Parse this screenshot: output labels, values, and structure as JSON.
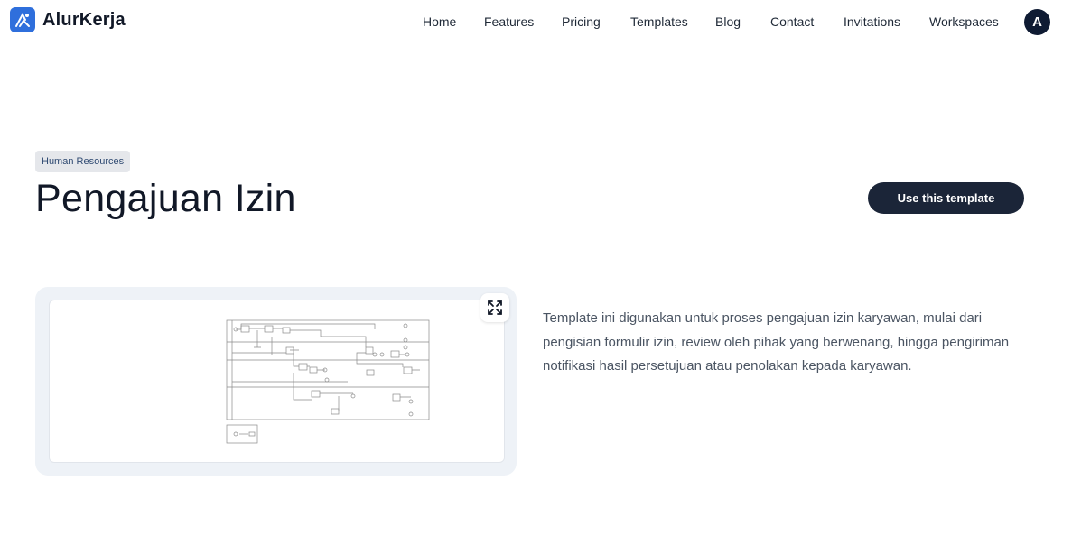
{
  "brand": {
    "name": "AlurKerja",
    "logo_icon": "workflow-logo-icon",
    "accent": "#2f6fdc"
  },
  "nav": [
    {
      "label": "Home"
    },
    {
      "label": "Features"
    },
    {
      "label": "Pricing"
    },
    {
      "label": "Templates"
    },
    {
      "label": "Blog"
    },
    {
      "label": "Contact"
    },
    {
      "label": "Invitations"
    },
    {
      "label": "Workspaces"
    }
  ],
  "user": {
    "avatar_initial": "A"
  },
  "template": {
    "category": "Human Resources",
    "title": "Pengajuan Izin",
    "cta_label": "Use this template",
    "description": "Template ini digunakan untuk proses pengajuan izin karyawan, mulai dari pengisian formulir izin, review oleh pihak yang berwenang, hingga pengiriman notifikasi hasil persetujuan atau penolakan kepada karyawan.",
    "preview_icon": "bpmn-diagram-thumbnail",
    "expand_icon": "expand-icon"
  },
  "colors": {
    "primary_button": "#1b2538",
    "avatar_bg": "#0f1b33",
    "badge_bg": "#e5e7eb"
  }
}
